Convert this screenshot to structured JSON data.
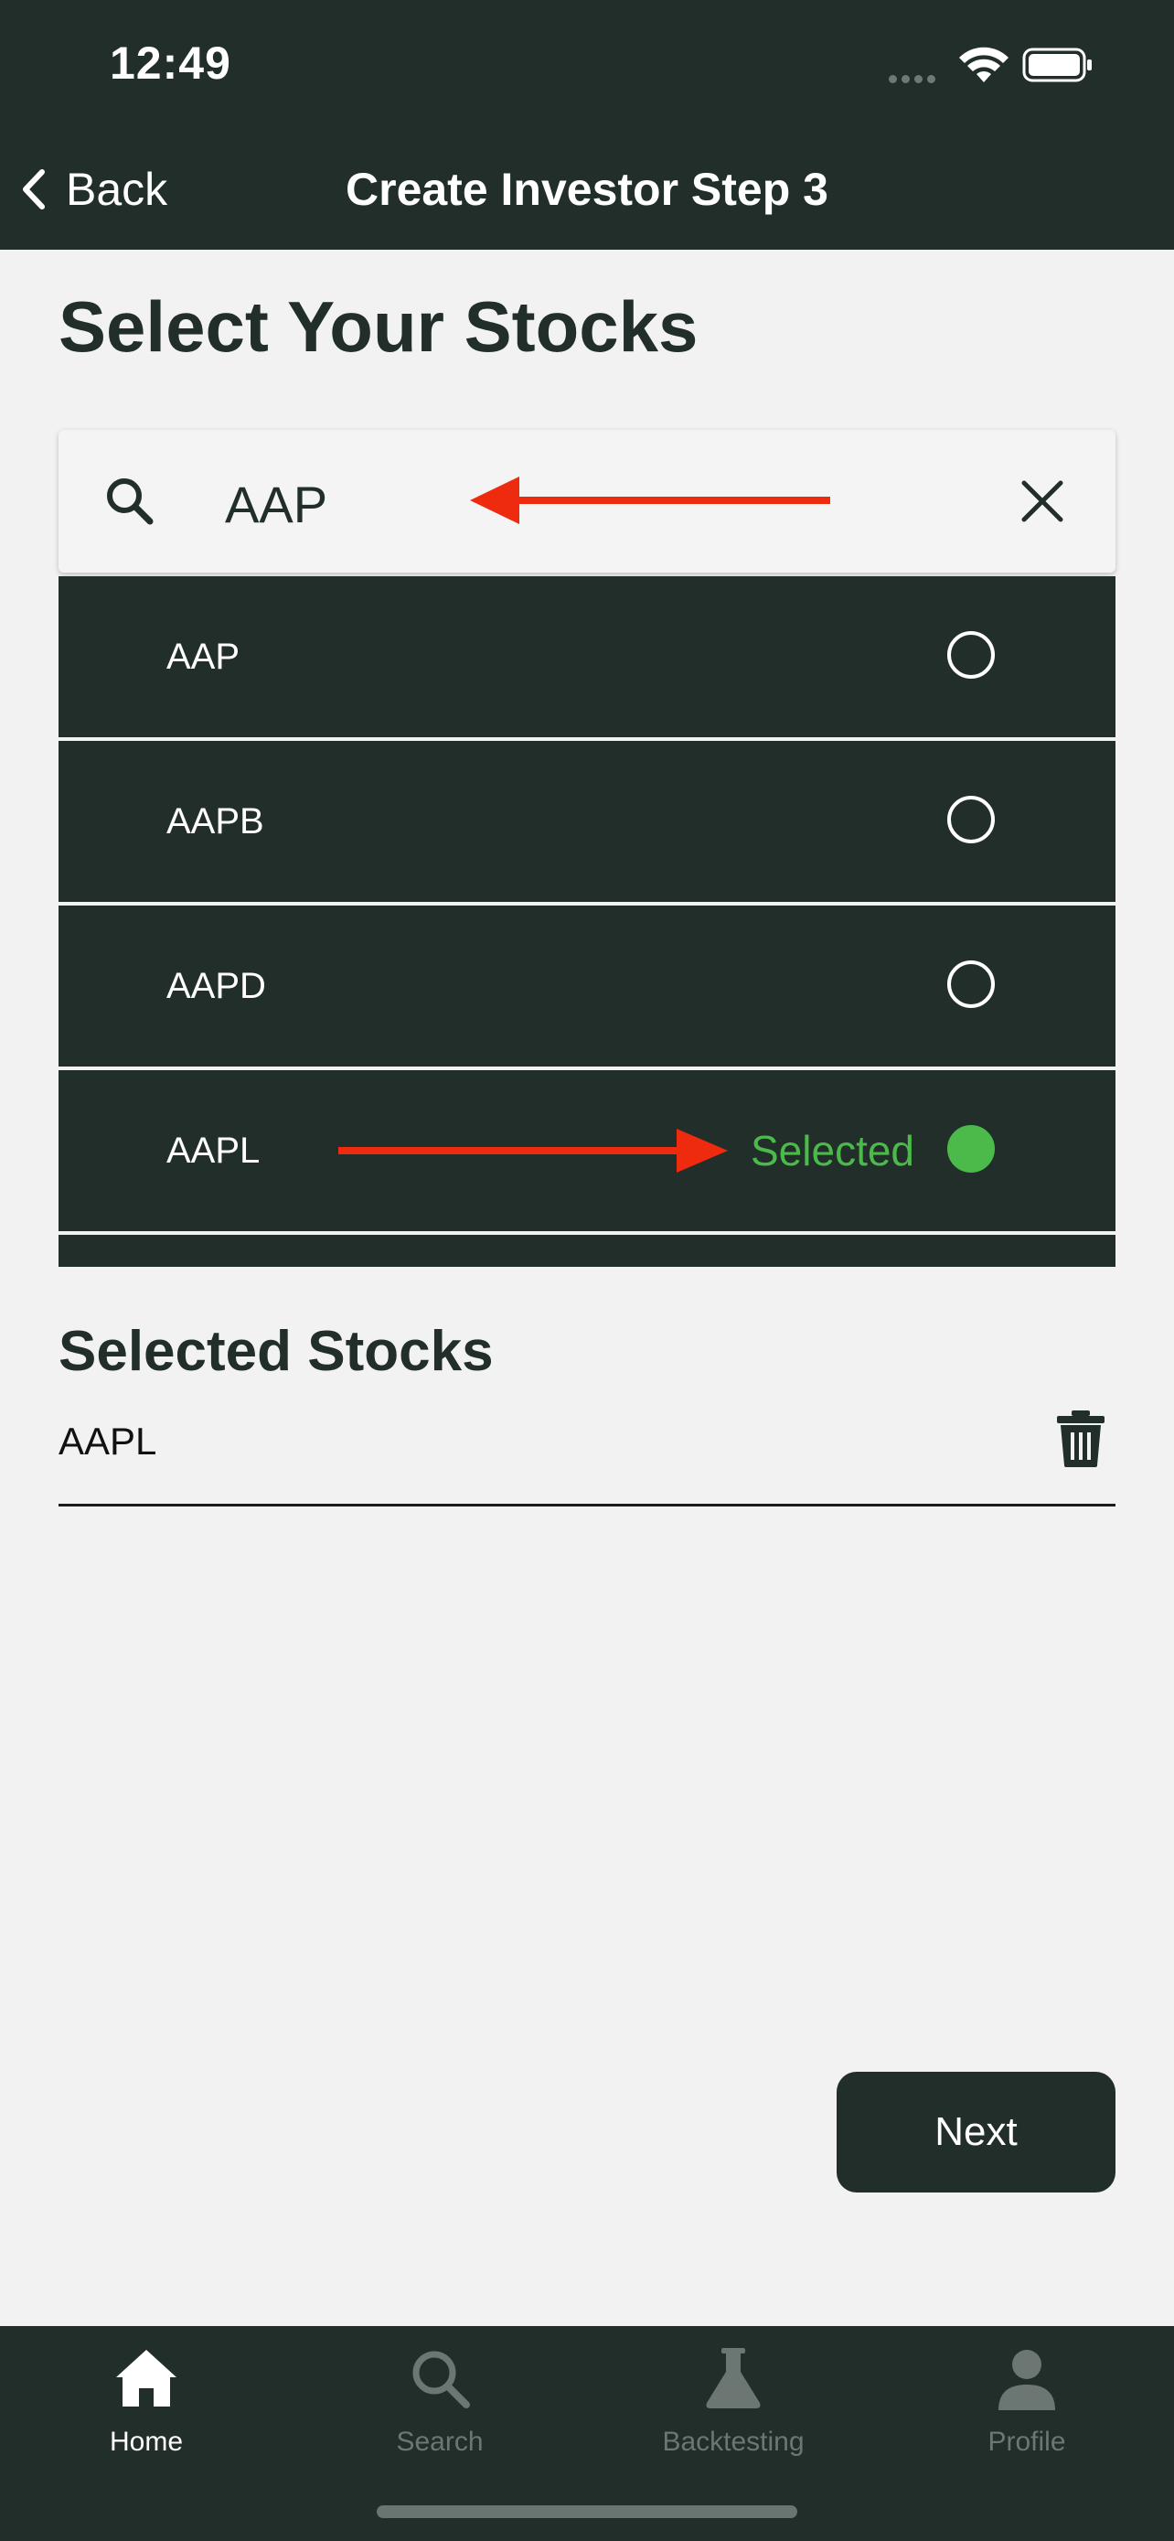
{
  "status_bar": {
    "time": "12:49"
  },
  "nav": {
    "back_label": "Back",
    "title": "Create Investor Step 3"
  },
  "page": {
    "heading": "Select Your Stocks"
  },
  "search": {
    "value": "AAP",
    "placeholder": "",
    "icon": "search-icon",
    "clear_icon": "close-icon"
  },
  "results": [
    {
      "symbol": "AAP",
      "selected": false
    },
    {
      "symbol": "AAPB",
      "selected": false
    },
    {
      "symbol": "AAPD",
      "selected": false
    },
    {
      "symbol": "AAPL",
      "selected": true,
      "selected_label": "Selected"
    }
  ],
  "selected_section": {
    "title": "Selected Stocks",
    "items": [
      {
        "symbol": "AAPL"
      }
    ],
    "delete_icon": "trash-icon"
  },
  "actions": {
    "next_label": "Next"
  },
  "tabbar": {
    "items": [
      {
        "label": "Home",
        "icon": "home-icon",
        "active": true
      },
      {
        "label": "Search",
        "icon": "search-icon",
        "active": false
      },
      {
        "label": "Backtesting",
        "icon": "flask-icon",
        "active": false
      },
      {
        "label": "Profile",
        "icon": "person-icon",
        "active": false
      }
    ]
  },
  "colors": {
    "primary": "#212e2a",
    "background": "#f2f2f2",
    "selected": "#4cba4a",
    "annotation_arrow": "#ee2a0f",
    "inactive_tab": "#6c7672"
  }
}
